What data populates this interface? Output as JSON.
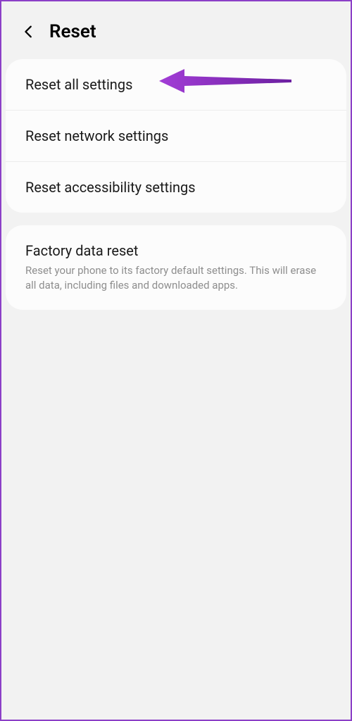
{
  "header": {
    "title": "Reset"
  },
  "group1": {
    "items": [
      {
        "title": "Reset all settings"
      },
      {
        "title": "Reset network settings"
      },
      {
        "title": "Reset accessibility settings"
      }
    ]
  },
  "group2": {
    "items": [
      {
        "title": "Factory data reset",
        "desc": "Reset your phone to its factory default settings. This will erase all data, including files and downloaded apps."
      }
    ]
  }
}
